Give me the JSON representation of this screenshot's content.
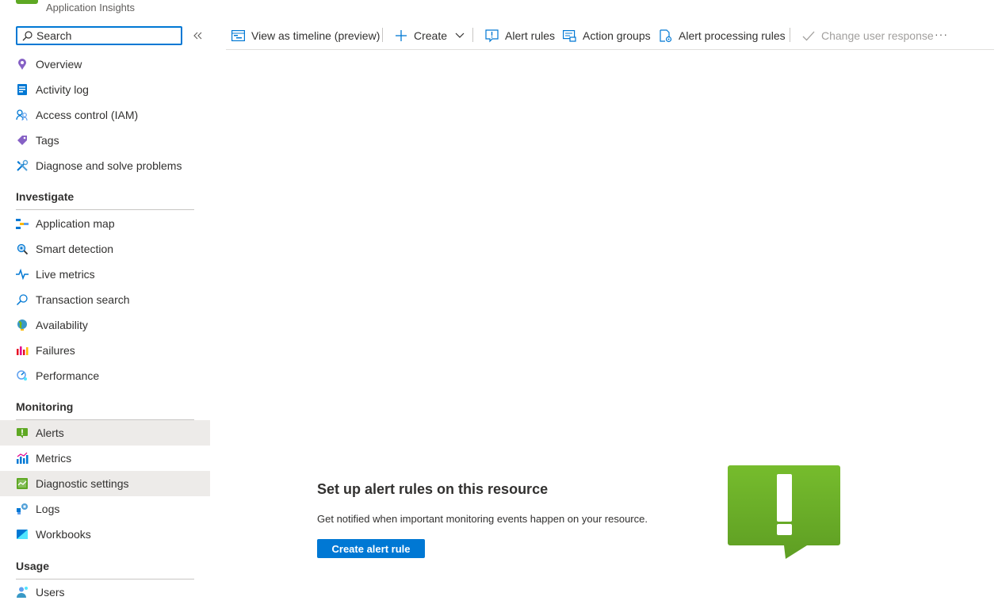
{
  "header": {
    "resource_type": "Application Insights"
  },
  "search": {
    "placeholder": "Search"
  },
  "sidebar": {
    "top_items": [
      {
        "label": "Overview",
        "icon": "overview-icon"
      },
      {
        "label": "Activity log",
        "icon": "activity-log-icon"
      },
      {
        "label": "Access control (IAM)",
        "icon": "iam-icon"
      },
      {
        "label": "Tags",
        "icon": "tag-icon"
      },
      {
        "label": "Diagnose and solve problems",
        "icon": "diagnose-icon"
      }
    ],
    "sections": [
      {
        "title": "Investigate",
        "items": [
          {
            "label": "Application map",
            "icon": "application-map-icon"
          },
          {
            "label": "Smart detection",
            "icon": "smart-detection-icon"
          },
          {
            "label": "Live metrics",
            "icon": "live-metrics-icon"
          },
          {
            "label": "Transaction search",
            "icon": "transaction-search-icon"
          },
          {
            "label": "Availability",
            "icon": "availability-icon"
          },
          {
            "label": "Failures",
            "icon": "failures-icon"
          },
          {
            "label": "Performance",
            "icon": "performance-icon"
          }
        ]
      },
      {
        "title": "Monitoring",
        "items": [
          {
            "label": "Alerts",
            "icon": "alerts-icon",
            "selected": true
          },
          {
            "label": "Metrics",
            "icon": "metrics-icon"
          },
          {
            "label": "Diagnostic settings",
            "icon": "diagnostic-settings-icon",
            "selected": true
          },
          {
            "label": "Logs",
            "icon": "logs-icon"
          },
          {
            "label": "Workbooks",
            "icon": "workbooks-icon"
          }
        ]
      },
      {
        "title": "Usage",
        "items": [
          {
            "label": "Users",
            "icon": "users-icon"
          }
        ]
      }
    ]
  },
  "toolbar": {
    "view_timeline": "View as timeline (preview)",
    "create": "Create",
    "alert_rules": "Alert rules",
    "action_groups": "Action groups",
    "alert_processing_rules": "Alert processing rules",
    "change_user_response": "Change user response",
    "more": "···"
  },
  "empty_state": {
    "title": "Set up alert rules on this resource",
    "description": "Get notified when important monitoring events happen on your resource.",
    "button": "Create alert rule"
  },
  "colors": {
    "accent": "#0078d4",
    "alert_green": "#5ea823",
    "selected_bg": "#edebe9"
  }
}
